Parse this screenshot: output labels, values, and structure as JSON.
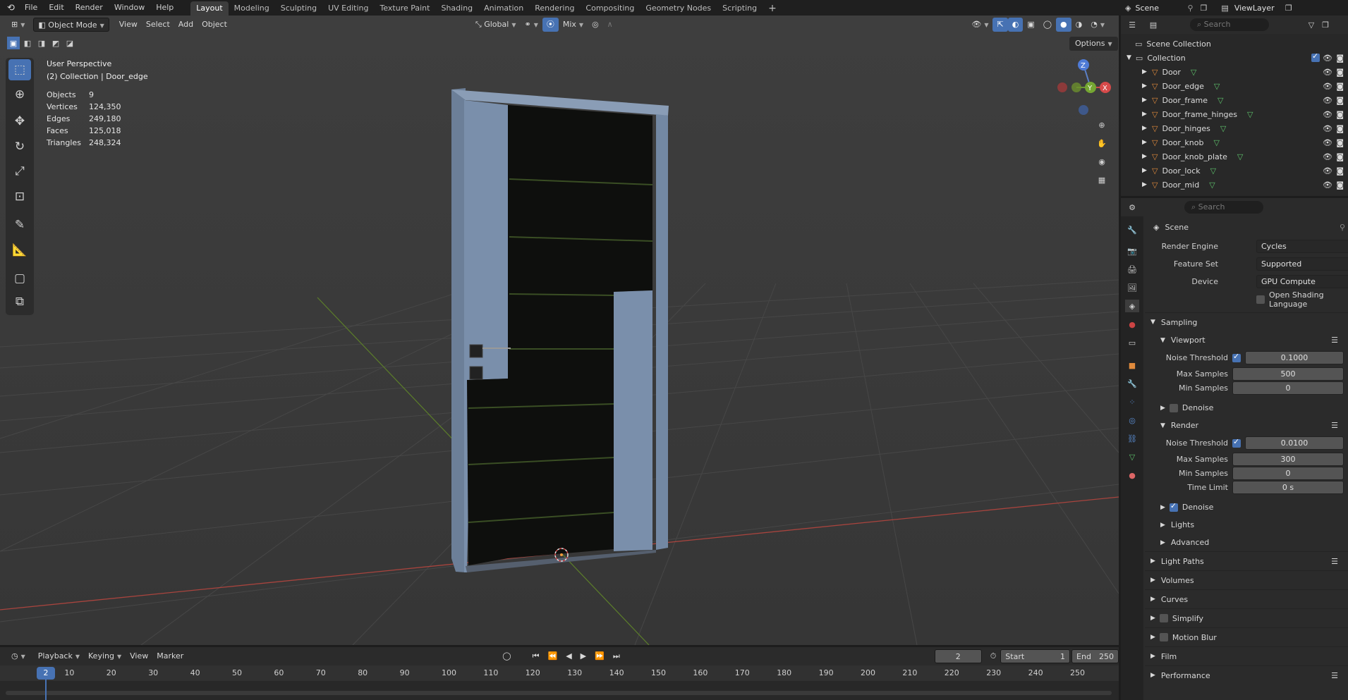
{
  "menu": [
    "File",
    "Edit",
    "Render",
    "Window",
    "Help"
  ],
  "workspaces": [
    "Layout",
    "Modeling",
    "Sculpting",
    "UV Editing",
    "Texture Paint",
    "Shading",
    "Animation",
    "Rendering",
    "Compositing",
    "Geometry Nodes",
    "Scripting"
  ],
  "active_workspace": "Layout",
  "scene_label": "Scene",
  "view_layer_label": "ViewLayer",
  "viewport_header": {
    "mode": "Object Mode",
    "menus": [
      "View",
      "Select",
      "Add",
      "Object"
    ],
    "orientation": "Global",
    "snap_mode": "Mix",
    "options": "Options"
  },
  "overlay_text": {
    "perspective": "User Perspective",
    "collection": "(2) Collection | Door_edge",
    "stats": [
      {
        "k": "Objects",
        "v": "9"
      },
      {
        "k": "Vertices",
        "v": "124,350"
      },
      {
        "k": "Edges",
        "v": "249,180"
      },
      {
        "k": "Faces",
        "v": "125,018"
      },
      {
        "k": "Triangles",
        "v": "248,324"
      }
    ]
  },
  "outliner": {
    "search_placeholder": "Search",
    "scene_collection": "Scene Collection",
    "collection": "Collection",
    "items": [
      "Door",
      "Door_edge",
      "Door_frame",
      "Door_frame_hinges",
      "Door_hinges",
      "Door_knob",
      "Door_knob_plate",
      "Door_lock",
      "Door_mid"
    ]
  },
  "properties": {
    "search_placeholder": "Search",
    "context": "Scene",
    "render_engine_label": "Render Engine",
    "render_engine": "Cycles",
    "feature_set_label": "Feature Set",
    "feature_set": "Supported",
    "device_label": "Device",
    "device": "GPU Compute",
    "osl_label": "Open Shading Language",
    "sampling": "Sampling",
    "viewport": "Viewport",
    "noise_threshold_label": "Noise Threshold",
    "vp_noise_threshold": "0.1000",
    "max_samples_label": "Max Samples",
    "vp_max_samples": "500",
    "min_samples_label": "Min Samples",
    "vp_min_samples": "0",
    "denoise_label": "Denoise",
    "render": "Render",
    "r_noise_threshold": "0.0100",
    "r_max_samples": "300",
    "r_min_samples": "0",
    "time_limit_label": "Time Limit",
    "time_limit": "0 s",
    "lights": "Lights",
    "advanced": "Advanced",
    "light_paths": "Light Paths",
    "volumes": "Volumes",
    "curves": "Curves",
    "simplify": "Simplify",
    "motion_blur": "Motion Blur",
    "film": "Film",
    "performance": "Performance"
  },
  "timeline": {
    "menus": [
      "Playback",
      "Keying",
      "View",
      "Marker"
    ],
    "current_frame": "2",
    "start_label": "Start",
    "start": "1",
    "end_label": "End",
    "end": "250",
    "ticks": [
      "10",
      "20",
      "30",
      "40",
      "50",
      "60",
      "70",
      "80",
      "90",
      "100",
      "110",
      "120",
      "130",
      "140",
      "150",
      "160",
      "170",
      "180",
      "190",
      "200",
      "210",
      "220",
      "230",
      "240",
      "250"
    ]
  },
  "colors": {
    "accent": "#4772b3",
    "door": "#7388a3",
    "x_axis": "#d34b4b",
    "y_axis": "#6b9a2b"
  }
}
